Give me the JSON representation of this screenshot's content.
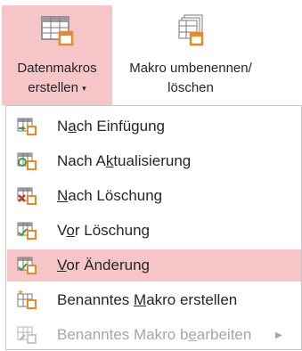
{
  "ribbon": {
    "create_label_line1": "Datenmakros",
    "create_label_line2": "erstellen",
    "create_caret": "▾",
    "rename_label_line1": "Makro umbenennen/",
    "rename_label_line2": "löschen"
  },
  "menu": {
    "items": [
      {
        "pre": "N",
        "acc": "a",
        "post": "ch Einfügung",
        "icon": "after-insert-icon"
      },
      {
        "pre": "Nach A",
        "acc": "k",
        "post": "tualisierung",
        "icon": "after-update-icon"
      },
      {
        "pre": "",
        "acc": "N",
        "post": "ach Löschung",
        "icon": "after-delete-icon"
      },
      {
        "pre": "V",
        "acc": "o",
        "post": "r Löschung",
        "icon": "before-delete-icon"
      },
      {
        "pre": "",
        "acc": "V",
        "post": "or Änderung",
        "icon": "before-change-icon"
      },
      {
        "pre": "Benanntes ",
        "acc": "M",
        "post": "akro erstellen",
        "icon": "create-named-macro-icon"
      },
      {
        "pre": "Benanntes Makro b",
        "acc": "e",
        "post": "arbeiten",
        "icon": "edit-named-macro-icon"
      }
    ],
    "submenu_arrow": "▶"
  },
  "colors": {
    "highlight": "#f5c5c8",
    "orange": "#e8892c",
    "green": "#3e9b4a",
    "red": "#c0392b",
    "disabled": "#a6a6a6"
  }
}
